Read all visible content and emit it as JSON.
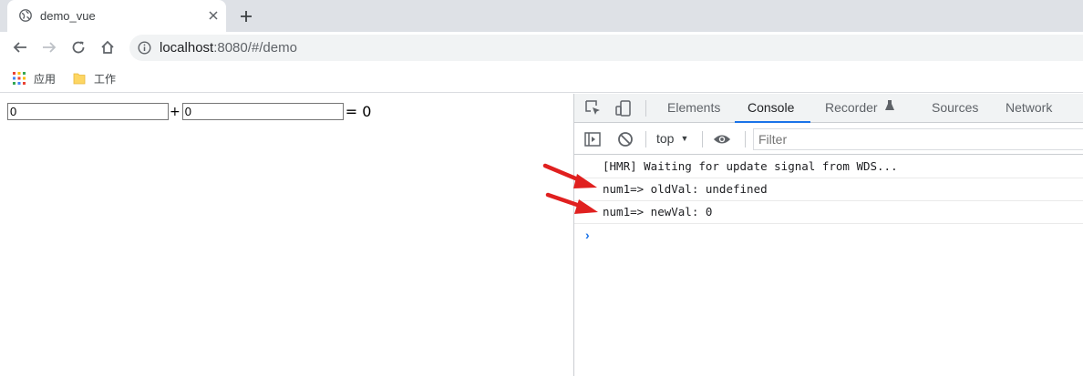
{
  "tab": {
    "title": "demo_vue"
  },
  "omnibox": {
    "host": "localhost",
    "rest": ":8080/#/demo"
  },
  "bookmarks": {
    "items": [
      {
        "label": "应用"
      },
      {
        "label": "工作"
      }
    ]
  },
  "page": {
    "num1_value": "0",
    "plus": "+",
    "num2_value": "0",
    "equals": "= 0"
  },
  "devtools": {
    "tabs": [
      {
        "label": "Elements"
      },
      {
        "label": "Console"
      },
      {
        "label": "Recorder"
      },
      {
        "label": "Sources"
      },
      {
        "label": "Network"
      }
    ],
    "context": "top",
    "filter_placeholder": "Filter",
    "console_lines": [
      "[HMR] Waiting for update signal from WDS...",
      "num1=> oldVal: undefined",
      "num1=> newVal: 0"
    ],
    "prompt": "›"
  },
  "colors": {
    "accent": "#1a73e8",
    "arrow": "#e0201f"
  }
}
